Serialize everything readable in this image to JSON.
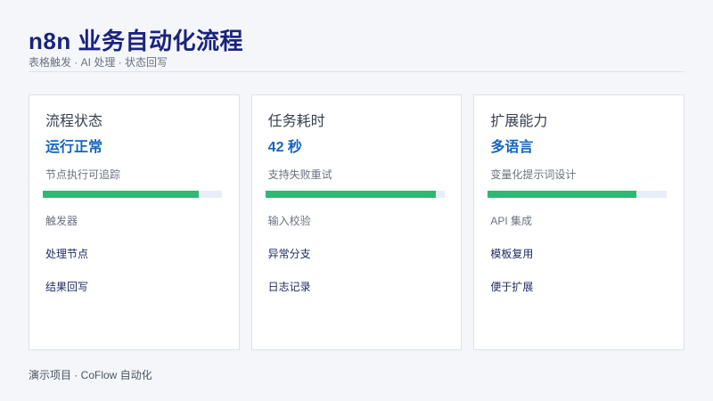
{
  "header": {
    "title": "n8n 业务自动化流程",
    "subtitle": "表格触发 · AI 处理 · 状态回写"
  },
  "cards": [
    {
      "title": "流程状态",
      "value": "运行正常",
      "description": "节点执行可追踪",
      "progress": 0.87,
      "items": [
        "触发器",
        "处理节点",
        "结果回写"
      ]
    },
    {
      "title": "任务耗时",
      "value": "42 秒",
      "description": "支持失败重试",
      "progress": 0.95,
      "items": [
        "输入校验",
        "异常分支",
        "日志记录"
      ]
    },
    {
      "title": "扩展能力",
      "value": "多语言",
      "description": "变量化提示词设计",
      "progress": 0.83,
      "items": [
        "API 集成",
        "模板复用",
        "便于扩展"
      ]
    }
  ],
  "footer": {
    "text": "演示项目 · CoFlow 自动化"
  },
  "colors": {
    "title": "#1a237e",
    "accent_value": "#1565c0",
    "progress_fill": "#2eb872",
    "progress_track": "#e8eef7",
    "background": "#f4f6fa"
  }
}
